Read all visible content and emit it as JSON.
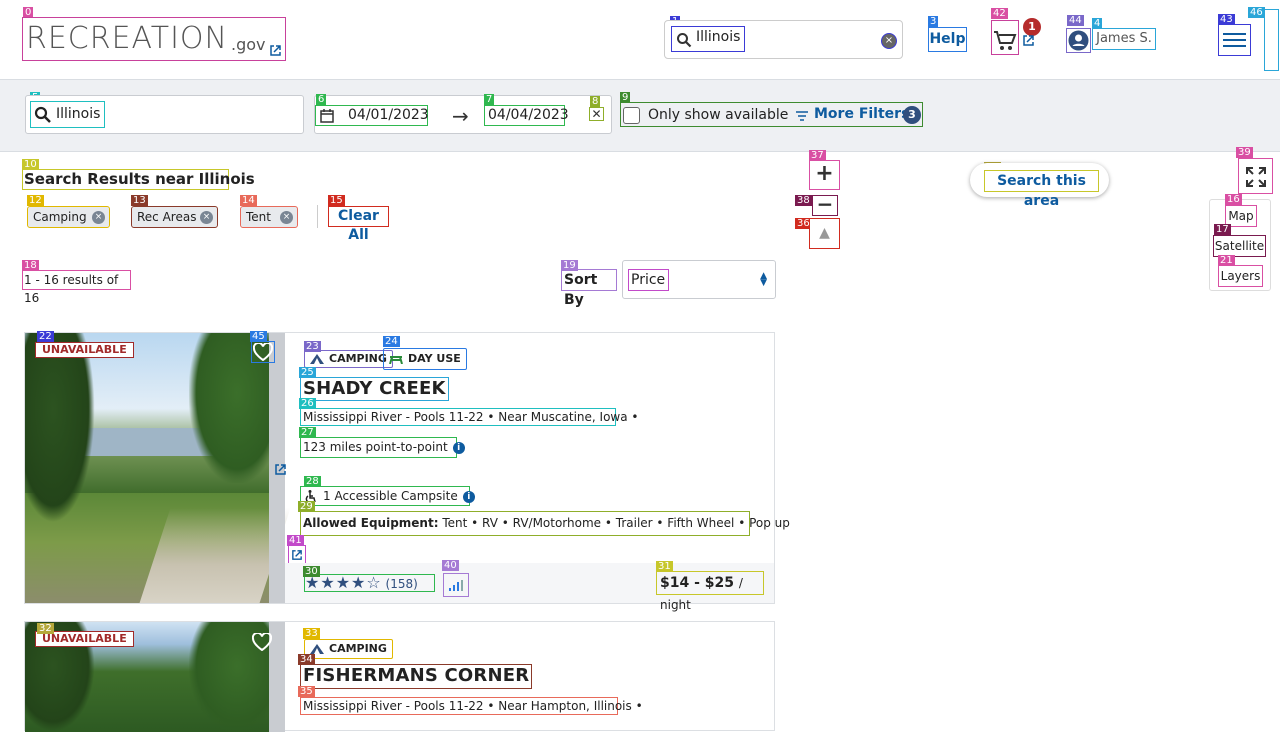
{
  "header": {
    "logo_text": "RECREATION",
    "logo_suffix": ".gov",
    "search_value": "Illinois",
    "clear_glyph": "×",
    "help_label": "Help",
    "cart_count": "1",
    "user_name": "James S."
  },
  "filters": {
    "location_value": "Illinois",
    "start_date": "04/01/2023",
    "end_date": "04/04/2023",
    "arrow": "→",
    "clear_dates_glyph": "✕",
    "only_available_label": "Only show available",
    "more_filters_label": "More Filters",
    "more_filters_count": "3"
  },
  "results": {
    "title": "Search Results near Illinois",
    "chips": [
      {
        "label": "Camping"
      },
      {
        "label": "Rec Areas"
      },
      {
        "label": "Tent"
      }
    ],
    "chip_remove_glyph": "×",
    "clear_all_label": "Clear All",
    "count_text": "1 - 16 results of 16",
    "sort_label": "Sort By",
    "sort_value": "Price"
  },
  "cards": [
    {
      "status": "UNAVAILABLE",
      "badges": [
        "CAMPING",
        "DAY USE"
      ],
      "title": "SHADY CREEK",
      "location": "Mississippi River - Pools 11-22 • Near Muscatine, Iowa •",
      "distance": "123 miles point-to-point",
      "accessible": "1 Accessible Campsite",
      "equipment_label": "Allowed Equipment:",
      "equipment": "Tent • RV • RV/Motorhome • Trailer • Fifth Wheel • Pop up",
      "rating": 4.5,
      "reviews": "(158)",
      "price": "$14 - $25",
      "price_unit": "/ night"
    },
    {
      "status": "UNAVAILABLE",
      "badges": [
        "CAMPING"
      ],
      "title": "FISHERMANS CORNER",
      "location": "Mississippi River - Pools 11-22 • Near Hampton, Illinois •"
    }
  ],
  "map": {
    "zoom_in": "+",
    "zoom_out": "−",
    "compass": "▲",
    "search_area_label": "Search this area",
    "layers": [
      "Map",
      "Satellite",
      "Layers"
    ]
  },
  "info_glyph": "i",
  "icons": [
    "search-icon",
    "calendar-icon",
    "cart-icon",
    "user-icon",
    "menu-icon",
    "heart-icon",
    "external-link-icon",
    "tent-icon",
    "picnic-icon",
    "accessible-icon",
    "star-icon",
    "signal-icon",
    "fullscreen-icon",
    "filter-icon"
  ],
  "colors": {
    "brand": "#0e5b9f",
    "alert": "#a12a2a",
    "badge": "#304f7e"
  }
}
